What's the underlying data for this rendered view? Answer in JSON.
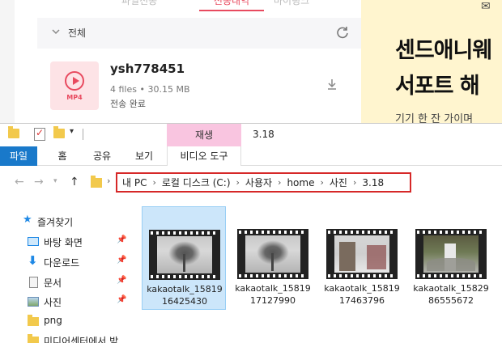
{
  "bg_app": {
    "tabs": [
      "파일전송",
      "전송내역",
      "마이링크"
    ],
    "filter_label": "전체",
    "file": {
      "type_badge": "MP4",
      "name": "ysh778451",
      "meta": "4 files • 30.15 MB",
      "status": "전송 완료"
    },
    "banner": {
      "line1": "센드애니웨",
      "line2": "서포트 해",
      "line3": "기기 한 잔 가이며"
    },
    "colors": {
      "accent": "#e84a5f",
      "banner_bg": "#fff5cf"
    }
  },
  "explorer": {
    "title": "3.18",
    "context_tab_header": "재생",
    "ribbon_tabs": {
      "file": "파일",
      "home": "홈",
      "share": "공유",
      "view": "보기",
      "video_tools": "비디오 도구"
    },
    "address_crumbs": [
      "내 PC",
      "로컬 디스크 (C:)",
      "사용자",
      "home",
      "사진",
      "3.18"
    ],
    "nav_items": [
      {
        "label": "즐겨찾기",
        "icon": "star-icon",
        "pinned": false
      },
      {
        "label": "바탕 화면",
        "icon": "desktop-icon",
        "pinned": true
      },
      {
        "label": "다운로드",
        "icon": "download-arrow-icon",
        "pinned": true
      },
      {
        "label": "문서",
        "icon": "document-icon",
        "pinned": true
      },
      {
        "label": "사진",
        "icon": "pictures-icon",
        "pinned": true
      },
      {
        "label": "png",
        "icon": "folder-icon",
        "pinned": false
      },
      {
        "label": "미디어센터에서 받",
        "icon": "folder-icon",
        "pinned": false
      }
    ],
    "files": [
      {
        "name_line1": "kakaotalk_15819",
        "name_line2": "16425430",
        "selected": true
      },
      {
        "name_line1": "kakaotalk_15819",
        "name_line2": "17127990",
        "selected": false
      },
      {
        "name_line1": "kakaotalk_15819",
        "name_line2": "17463796",
        "selected": false
      },
      {
        "name_line1": "kakaotalk_15829",
        "name_line2": "86555672",
        "selected": false
      }
    ],
    "colors": {
      "file_tab": "#1979ca",
      "context_tab": "#f9c5e0",
      "address_highlight": "#d62828",
      "selection": "#cce6fa"
    }
  }
}
